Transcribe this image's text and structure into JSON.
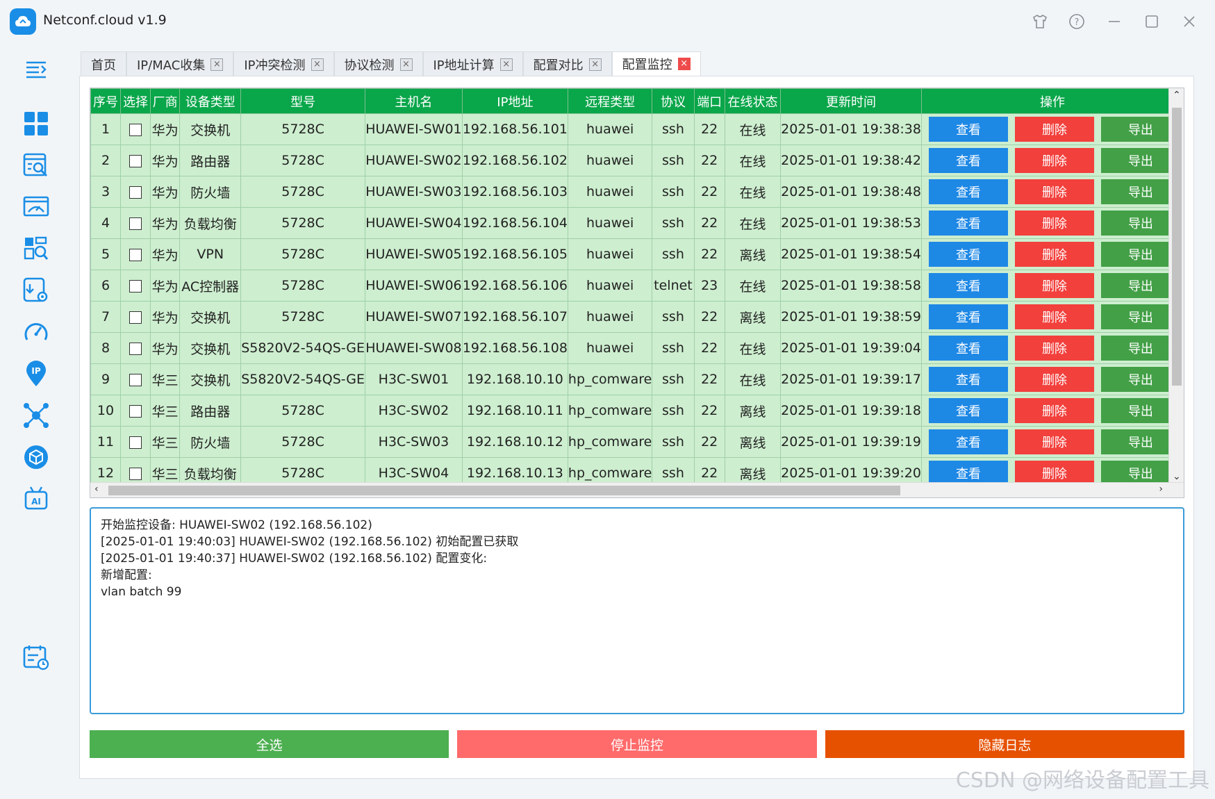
{
  "app": {
    "title": "Netconf.cloud v1.9"
  },
  "tabs": [
    {
      "label": "首页",
      "closable": false
    },
    {
      "label": "IP/MAC收集",
      "closable": true
    },
    {
      "label": "IP冲突检测",
      "closable": true
    },
    {
      "label": "协议检测",
      "closable": true
    },
    {
      "label": "IP地址计算",
      "closable": true
    },
    {
      "label": "配置对比",
      "closable": true
    },
    {
      "label": "配置监控",
      "closable": true,
      "active": true
    }
  ],
  "sidebar_icons": [
    "menu-toggle-icon",
    "dashboard-icon",
    "search-doc-icon",
    "monitor-icon",
    "data-search-icon",
    "config-download-icon",
    "speedometer-icon",
    "ip-location-icon",
    "network-topology-icon",
    "package-box-icon",
    "ai-robot-icon",
    "schedule-calendar-icon"
  ],
  "table": {
    "headers": [
      "序号",
      "选择",
      "厂商",
      "设备类型",
      "型号",
      "主机名",
      "IP地址",
      "远程类型",
      "协议",
      "端口",
      "在线状态",
      "更新时间",
      "操作"
    ],
    "buttons": {
      "view": "查看",
      "delete": "删除",
      "export": "导出"
    },
    "rows": [
      [
        "1",
        "",
        "华为",
        "交换机",
        "5728C",
        "HUAWEI-SW01",
        "192.168.56.101",
        "huawei",
        "ssh",
        "22",
        "在线",
        "2025-01-01 19:38:38"
      ],
      [
        "2",
        "",
        "华为",
        "路由器",
        "5728C",
        "HUAWEI-SW02",
        "192.168.56.102",
        "huawei",
        "ssh",
        "22",
        "在线",
        "2025-01-01 19:38:42"
      ],
      [
        "3",
        "",
        "华为",
        "防火墙",
        "5728C",
        "HUAWEI-SW03",
        "192.168.56.103",
        "huawei",
        "ssh",
        "22",
        "在线",
        "2025-01-01 19:38:48"
      ],
      [
        "4",
        "",
        "华为",
        "负载均衡",
        "5728C",
        "HUAWEI-SW04",
        "192.168.56.104",
        "huawei",
        "ssh",
        "22",
        "在线",
        "2025-01-01 19:38:53"
      ],
      [
        "5",
        "",
        "华为",
        "VPN",
        "5728C",
        "HUAWEI-SW05",
        "192.168.56.105",
        "huawei",
        "ssh",
        "22",
        "离线",
        "2025-01-01 19:38:54"
      ],
      [
        "6",
        "",
        "华为",
        "AC控制器",
        "5728C",
        "HUAWEI-SW06",
        "192.168.56.106",
        "huawei",
        "telnet",
        "23",
        "在线",
        "2025-01-01 19:38:58"
      ],
      [
        "7",
        "",
        "华为",
        "交换机",
        "5728C",
        "HUAWEI-SW07",
        "192.168.56.107",
        "huawei",
        "ssh",
        "22",
        "离线",
        "2025-01-01 19:38:59"
      ],
      [
        "8",
        "",
        "华为",
        "交换机",
        "S5820V2-54QS-GE",
        "HUAWEI-SW08",
        "192.168.56.108",
        "huawei",
        "ssh",
        "22",
        "在线",
        "2025-01-01 19:39:04"
      ],
      [
        "9",
        "",
        "华三",
        "交换机",
        "S5820V2-54QS-GE",
        "H3C-SW01",
        "192.168.10.10",
        "hp_comware",
        "ssh",
        "22",
        "在线",
        "2025-01-01 19:39:17"
      ],
      [
        "10",
        "",
        "华三",
        "路由器",
        "5728C",
        "H3C-SW02",
        "192.168.10.11",
        "hp_comware",
        "ssh",
        "22",
        "离线",
        "2025-01-01 19:39:18"
      ],
      [
        "11",
        "",
        "华三",
        "防火墙",
        "5728C",
        "H3C-SW03",
        "192.168.10.12",
        "hp_comware",
        "ssh",
        "22",
        "离线",
        "2025-01-01 19:39:19"
      ],
      [
        "12",
        "",
        "华三",
        "负载均衡",
        "5728C",
        "H3C-SW04",
        "192.168.10.13",
        "hp_comware",
        "ssh",
        "22",
        "离线",
        "2025-01-01 19:39:20"
      ]
    ]
  },
  "log": {
    "lines": [
      "开始监控设备: HUAWEI-SW02 (192.168.56.102)",
      "[2025-01-01 19:40:03] HUAWEI-SW02 (192.168.56.102) 初始配置已获取",
      "[2025-01-01 19:40:37] HUAWEI-SW02 (192.168.56.102) 配置变化:",
      "新增配置:",
      "vlan batch 99"
    ]
  },
  "actions": {
    "select_all": "全选",
    "stop_monitor": "停止监控",
    "hide_log": "隐藏日志"
  },
  "colors": {
    "header_green": "#0aa64a",
    "row_green": "#cdeecf",
    "view_blue": "#1e88e5",
    "delete_red": "#f2403c",
    "export_green": "#43a047",
    "select_all": "#4caf50",
    "stop_monitor": "#ff6b6b",
    "hide_log": "#e65100"
  },
  "watermark": "CSDN @网络设备配置工具"
}
